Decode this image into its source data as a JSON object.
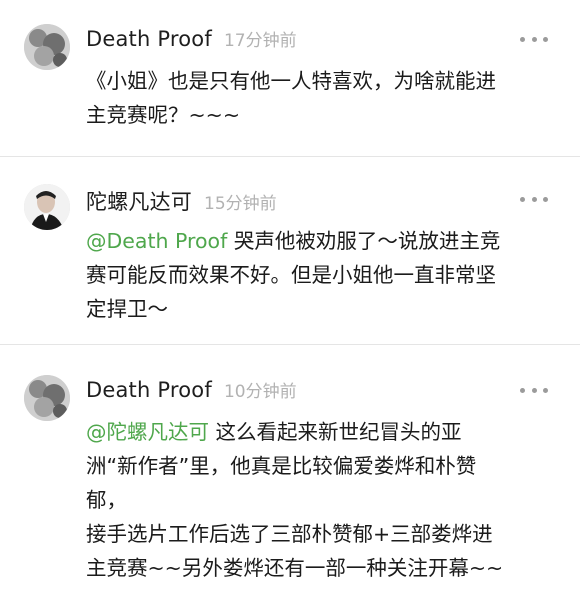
{
  "comments": [
    {
      "author": "Death Proof",
      "time": "17分钟前",
      "mention": "",
      "text": "《小姐》也是只有他一人特喜欢，为啥就能进\n主竞赛呢？~~~"
    },
    {
      "author": "陀螺凡达可",
      "time": "15分钟前",
      "mention": "@Death Proof",
      "text": " 哭声他被劝服了～说放进主竞\n赛可能反而效果不好。但是小姐他一直非常坚\n定捍卫～"
    },
    {
      "author": "Death Proof",
      "time": "10分钟前",
      "mention": "@陀螺凡达可",
      "text": "  这么看起来新世纪冒头的亚\n洲“新作者”里，他真是比较偏爱娄烨和朴赞\n郁，\n接手选片工作后选了三部朴赞郁+三部娄烨进\n主竞赛~~另外娄烨还有一部一种关注开幕~~"
    }
  ]
}
